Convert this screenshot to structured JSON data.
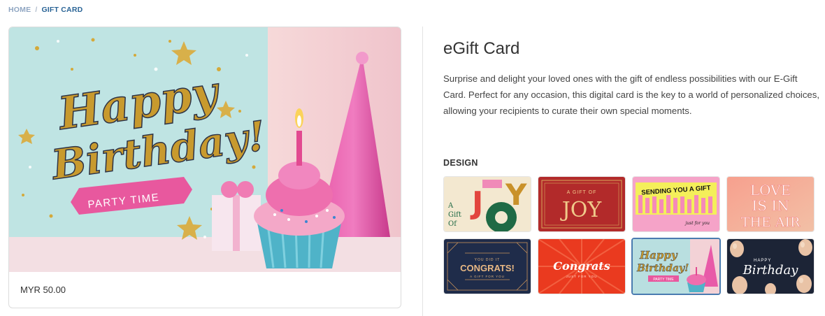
{
  "breadcrumb": {
    "home": "HOME",
    "separator": "/",
    "current": "GIFT CARD"
  },
  "preview": {
    "art": {
      "line1": "Happy",
      "line2": "Birthday!",
      "ribbon": "PARTY TIME"
    },
    "price": "MYR 50.00"
  },
  "product": {
    "title": "eGift Card",
    "description": "Surprise and delight your loved ones with the gift of endless possibilities with our E-Gift Card. Perfect for any occasion, this digital card is the key to a world of personalized choices, allowing your recipients to curate their own special moments."
  },
  "design": {
    "label": "DESIGN",
    "selected_index": 6,
    "thumbs": [
      {
        "name": "joy-colorful",
        "texts": [
          "A",
          "Gift",
          "Of",
          "JOY"
        ],
        "bg": "#f3e8d0"
      },
      {
        "name": "joy-red",
        "texts": [
          "A GIFT OF",
          "JOY"
        ],
        "bg": "#b22a2a"
      },
      {
        "name": "sending-you-a-gift",
        "texts": [
          "SENDING YOU A GIFT",
          "just for you"
        ],
        "bg": "#f5a3c8"
      },
      {
        "name": "love-is-in-the-air",
        "texts": [
          "LOVE",
          "IS IN",
          "THE AIR"
        ],
        "bg": "#f08a7e"
      },
      {
        "name": "congrats-navy",
        "texts": [
          "YOU DID IT",
          "CONGRATS!",
          "A GIFT FOR YOU"
        ],
        "bg": "#1f2c4a"
      },
      {
        "name": "congrats-red",
        "texts": [
          "Congrats",
          "JUST FOR YOU"
        ],
        "bg": "#ea3a1f"
      },
      {
        "name": "happy-birthday-cupcake",
        "texts": [
          "Happy",
          "Birthday!",
          "PARTY TIME"
        ],
        "bg": "#b9dfe0"
      },
      {
        "name": "happy-birthday-balloons",
        "texts": [
          "HAPPY",
          "Birthday"
        ],
        "bg": "#1c2436"
      }
    ]
  }
}
